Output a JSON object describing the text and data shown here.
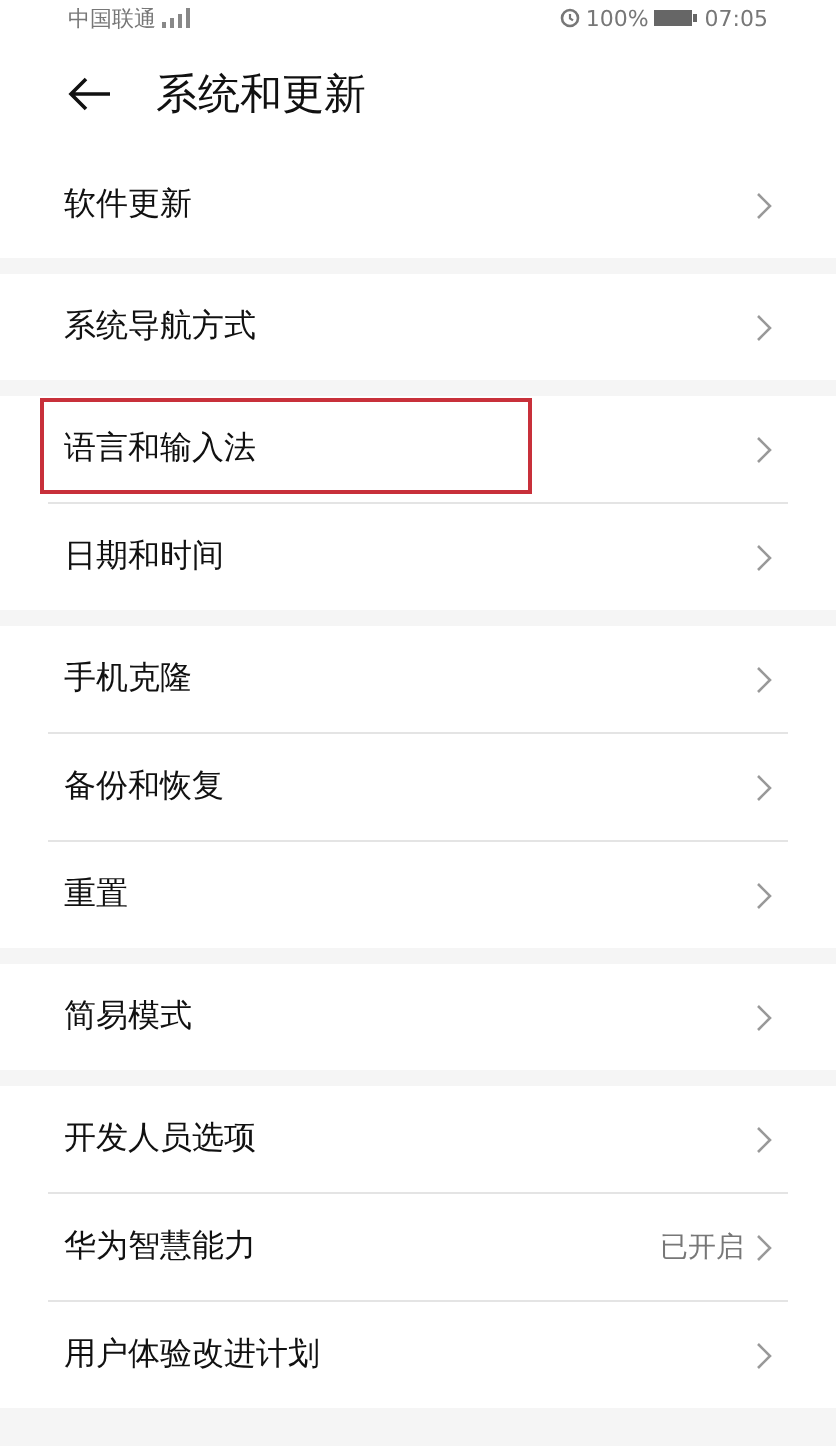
{
  "status_bar": {
    "carrier": "中国联通",
    "battery": "100%",
    "time": "07:05"
  },
  "header": {
    "title": "系统和更新"
  },
  "groups": [
    {
      "items": [
        {
          "label": "软件更新",
          "highlighted": false
        }
      ]
    },
    {
      "items": [
        {
          "label": "系统导航方式",
          "highlighted": false
        }
      ]
    },
    {
      "items": [
        {
          "label": "语言和输入法",
          "highlighted": true
        },
        {
          "label": "日期和时间",
          "highlighted": false
        }
      ]
    },
    {
      "items": [
        {
          "label": "手机克隆",
          "highlighted": false
        },
        {
          "label": "备份和恢复",
          "highlighted": false
        },
        {
          "label": "重置",
          "highlighted": false
        }
      ]
    },
    {
      "items": [
        {
          "label": "简易模式",
          "highlighted": false
        }
      ]
    },
    {
      "items": [
        {
          "label": "开发人员选项",
          "highlighted": false
        },
        {
          "label": "华为智慧能力",
          "value": "已开启",
          "highlighted": false
        },
        {
          "label": "用户体验改进计划",
          "highlighted": false
        }
      ]
    }
  ]
}
